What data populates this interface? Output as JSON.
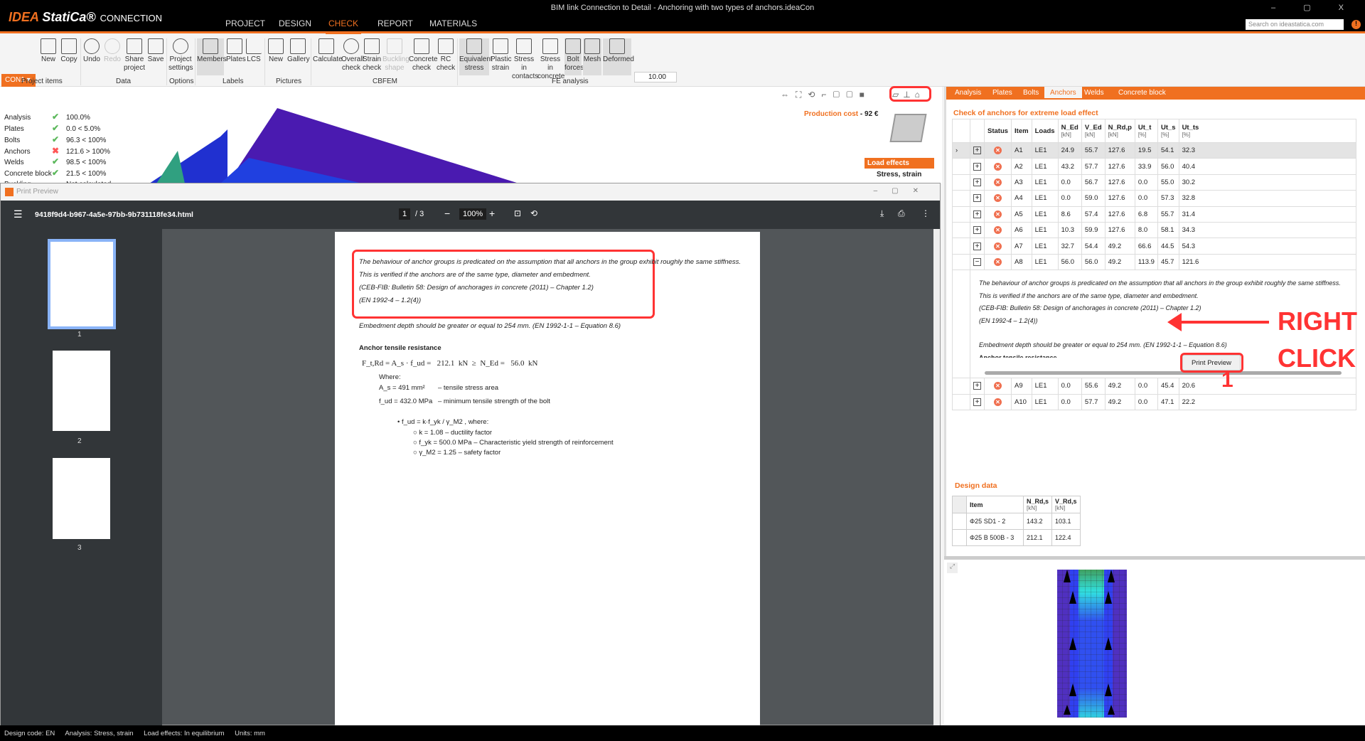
{
  "app": {
    "logo": "IDEA StatiCa",
    "product": "CONNECTION",
    "window_title": "BIM link Connection to Detail - Anchoring with two types of anchors.ideaCon",
    "search_placeholder": "Search on ideastatica.com",
    "window_controls": "– ▢ X"
  },
  "menu": [
    "PROJECT",
    "DESIGN",
    "CHECK",
    "REPORT",
    "MATERIALS"
  ],
  "ribbon": {
    "item": "CON1",
    "zoom_value": "10.00",
    "buttons": [
      {
        "label": "New"
      },
      {
        "label": "Copy"
      },
      {
        "label": "Undo"
      },
      {
        "label": "Redo"
      },
      {
        "label": "Share project"
      },
      {
        "label": "Save"
      },
      {
        "label": "Project settings"
      },
      {
        "label": "Members"
      },
      {
        "label": "Plates"
      },
      {
        "label": "LCS"
      },
      {
        "label": "New"
      },
      {
        "label": "Gallery"
      },
      {
        "label": "Calculate"
      },
      {
        "label": "Overall check"
      },
      {
        "label": "Strain check"
      },
      {
        "label": "Buckling shape"
      },
      {
        "label": "Concrete check"
      },
      {
        "label": "RC check"
      },
      {
        "label": "Equivalent stress"
      },
      {
        "label": "Plastic strain"
      },
      {
        "label": "Stress in contacts"
      },
      {
        "label": "Stress in concrete"
      },
      {
        "label": "Bolt forces"
      },
      {
        "label": "Mesh"
      },
      {
        "label": "Deformed"
      }
    ],
    "groups": [
      "Project items",
      "Data",
      "Options",
      "Labels",
      "Pictures",
      "CBFEM",
      "FE analysis"
    ]
  },
  "summary": [
    {
      "label": "Analysis",
      "status": "ok",
      "value": "100.0%"
    },
    {
      "label": "Plates",
      "status": "ok",
      "value": "0.0 < 5.0%"
    },
    {
      "label": "Bolts",
      "status": "ok",
      "value": "96.3 < 100%"
    },
    {
      "label": "Anchors",
      "status": "fail",
      "value": "121.6 > 100%"
    },
    {
      "label": "Welds",
      "status": "ok",
      "value": "98.5 < 100%"
    },
    {
      "label": "Concrete block",
      "status": "ok",
      "value": "21.5 < 100%"
    },
    {
      "label": "Buckling",
      "status": "",
      "value": "Not calculated"
    }
  ],
  "viewport": {
    "production_cost_label": "Production cost",
    "production_cost_value": "- 92 €",
    "load_effects": "Load effects",
    "stress_strain": "Stress, strain"
  },
  "print_preview": {
    "title": "Print Preview",
    "filename": "9418f9d4-b967-4a5e-97bb-9b731118fe34.html",
    "page": "1",
    "pages": "/ 3",
    "zoom": "100%",
    "thumbs": [
      "1",
      "2",
      "3"
    ],
    "note": [
      "The behaviour of anchor groups is predicated on the assumption that all anchors in the group exhibit roughly the same stiffness.",
      "This is verified if the anchors are of the same type, diameter and embedment.",
      "(CEB-FIB: Bulletin 58: Design of anchorages in concrete (2011) – Chapter 1.2)",
      "(EN 1992-4 – 1.2(4))",
      "Embedment depth should be greater or equal to 254 mm. (EN 1992-1-1 – Equation 8.6)"
    ],
    "heading": "Anchor tensile resistance",
    "formula": "F_t,Rd = A_s · f_ud =   212.1  kN  ≥  N_Ed =   56.0  kN",
    "where": "Where:",
    "as": "A_s = 491 mm²",
    "as_desc": "– tensile stress area",
    "fud": "f_ud = 432.0 MPa",
    "fud_desc": "– minimum tensile strength of the bolt",
    "fud_def": "f_ud = k·f_yk / γ_M2 , where:",
    "k": "k =  1.08 – ductility factor",
    "fyk": "f_yk =  500.0 MPa – Characteristic yield strength of reinforcement",
    "gm2": "γ_M2 =  1.25 – safety factor"
  },
  "right_panel": {
    "tabs": [
      "Analysis",
      "Plates",
      "Bolts",
      "Anchors",
      "Welds",
      "Concrete block"
    ],
    "title": "Check of anchors for extreme load effect",
    "columns": [
      {
        "h": "Status",
        "u": ""
      },
      {
        "h": "Item",
        "u": ""
      },
      {
        "h": "Loads",
        "u": ""
      },
      {
        "h": "N_Ed",
        "u": "[kN]"
      },
      {
        "h": "V_Ed",
        "u": "[kN]"
      },
      {
        "h": "N_Rd,p",
        "u": "[kN]"
      },
      {
        "h": "Ut_t",
        "u": "[%]"
      },
      {
        "h": "Ut_s",
        "u": "[%]"
      },
      {
        "h": "Ut_ts",
        "u": "[%]"
      }
    ],
    "rows": [
      [
        "A1",
        "LE1",
        "24.9",
        "55.7",
        "127.6",
        "19.5",
        "54.1",
        "32.3"
      ],
      [
        "A2",
        "LE1",
        "43.2",
        "57.7",
        "127.6",
        "33.9",
        "56.0",
        "40.4"
      ],
      [
        "A3",
        "LE1",
        "0.0",
        "56.7",
        "127.6",
        "0.0",
        "55.0",
        "30.2"
      ],
      [
        "A4",
        "LE1",
        "0.0",
        "59.0",
        "127.6",
        "0.0",
        "57.3",
        "32.8"
      ],
      [
        "A5",
        "LE1",
        "8.6",
        "57.4",
        "127.6",
        "6.8",
        "55.7",
        "31.4"
      ],
      [
        "A6",
        "LE1",
        "10.3",
        "59.9",
        "127.6",
        "8.0",
        "58.1",
        "34.3"
      ],
      [
        "A7",
        "LE1",
        "32.7",
        "54.4",
        "49.2",
        "66.6",
        "44.5",
        "54.3"
      ],
      [
        "A8",
        "LE1",
        "56.0",
        "56.0",
        "49.2",
        "113.9",
        "45.7",
        "121.6"
      ],
      [
        "A9",
        "LE1",
        "0.0",
        "55.6",
        "49.2",
        "0.0",
        "45.4",
        "20.6"
      ],
      [
        "A10",
        "LE1",
        "0.0",
        "57.7",
        "49.2",
        "0.0",
        "47.1",
        "22.2"
      ]
    ],
    "detail_heading": "Anchor tensile resistance",
    "context_menu": "Print Preview",
    "design_title": "Design data",
    "design_columns": [
      "Item",
      "N_Rd,s",
      "V_Rd,s"
    ],
    "design_units": "[kN]",
    "design_rows": [
      [
        "Φ25 SD1 - 2",
        "143.2",
        "103.1"
      ],
      [
        "Φ25 B 500B - 3",
        "212.1",
        "122.4"
      ]
    ]
  },
  "annotations": {
    "right": "RIGHT",
    "click": "CLICK",
    "step": "1"
  },
  "status": [
    "Design code: EN",
    "Analysis: Stress, strain",
    "Load effects: In equilibrium",
    "Units: mm"
  ]
}
